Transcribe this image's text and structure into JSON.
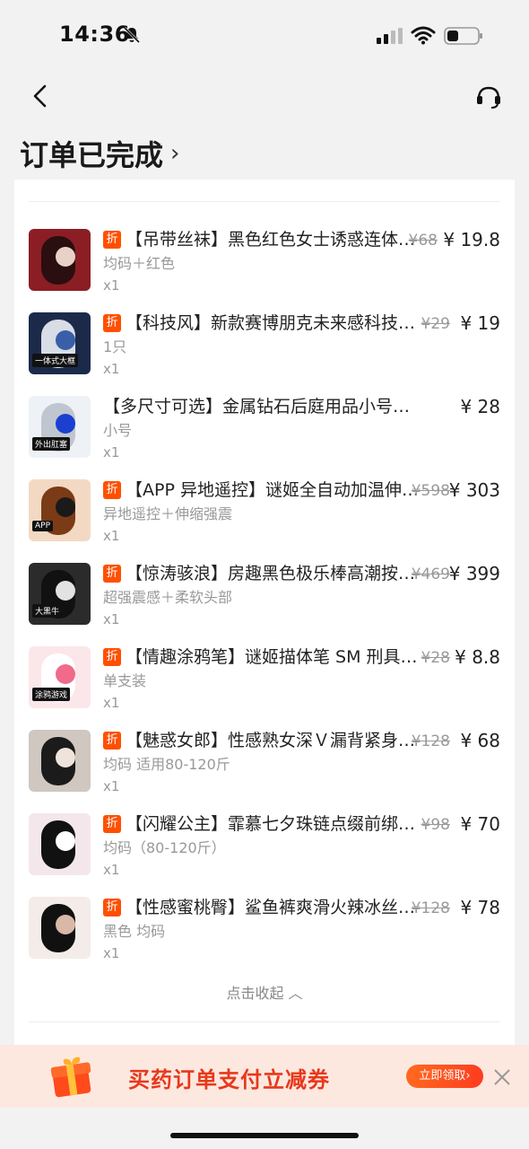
{
  "status_bar": {
    "time": "14:36"
  },
  "header": {
    "order_status": "订单已完成",
    "chevron": "›"
  },
  "items": [
    {
      "discount_badge": "折",
      "title": "【吊带丝袜】黑色红色女士诱惑连体丝袜",
      "old_price": "¥68",
      "price": "¥ 19.8",
      "spec": "均码＋红色",
      "qty": "x1"
    },
    {
      "discount_badge": "折",
      "title": "【科技风】新款赛博朋克未来感科技眼罩",
      "old_price": "¥29",
      "price": "¥ 19",
      "spec": "1只",
      "qty": "x1"
    },
    {
      "discount_badge": "",
      "title": "【多尺寸可选】金属钻石后庭用品小号大号肛塞",
      "old_price": "",
      "price": "¥ 28",
      "spec": "小号",
      "qty": "x1"
    },
    {
      "discount_badge": "折",
      "title": "【APP 异地遥控】谜姬全自动加温伸缩炮机",
      "old_price": "¥598",
      "price": "¥ 303",
      "spec": "异地遥控＋伸缩强震",
      "qty": "x1"
    },
    {
      "discount_badge": "折",
      "title": "【惊涛骇浪】房趣黑色极乐棒高潮按摩器",
      "old_price": "¥469",
      "price": "¥ 399",
      "spec": "超强震感＋柔软头部",
      "qty": "x1"
    },
    {
      "discount_badge": "折",
      "title": "【情趣涂鸦笔】谜姬描体笔 SM 刑具道具",
      "old_price": "¥28",
      "price": "¥ 8.8",
      "spec": "单支装",
      "qty": "x1"
    },
    {
      "discount_badge": "折",
      "title": "【魅惑女郎】性感熟女深Ｖ漏背紧身睡裙",
      "old_price": "¥128",
      "price": "¥ 68",
      "spec": "均码 适用80-120斤",
      "qty": "x1"
    },
    {
      "discount_badge": "折",
      "title": "【闪耀公主】霏慕七夕珠链点缀前绑带套装",
      "old_price": "¥98",
      "price": "¥ 70",
      "spec": "均码（80-120斤）",
      "qty": "x1"
    },
    {
      "discount_badge": "折",
      "title": "【性感蜜桃臀】鲨鱼裤爽滑火辣冰丝打底裤",
      "old_price": "¥128",
      "price": "¥ 78",
      "spec": "黑色 均码",
      "qty": "x1"
    }
  ],
  "thumb_labels": [
    "",
    "一体式大框",
    "外出肛塞",
    "APP",
    "大黑牛",
    "涂鸦游戏",
    "",
    "",
    ""
  ],
  "collapse_label": "点击收起 ︿",
  "banner": {
    "text": "买药订单支付立减券",
    "claim_label": "立即领取›"
  },
  "colors": {
    "accent": "#ff5000",
    "banner_bg": "#fde8e0",
    "banner_text": "#e8381b"
  },
  "icons": {
    "back": "back-arrow-icon",
    "support": "headset-icon",
    "close": "close-icon",
    "gift": "gift-icon"
  }
}
